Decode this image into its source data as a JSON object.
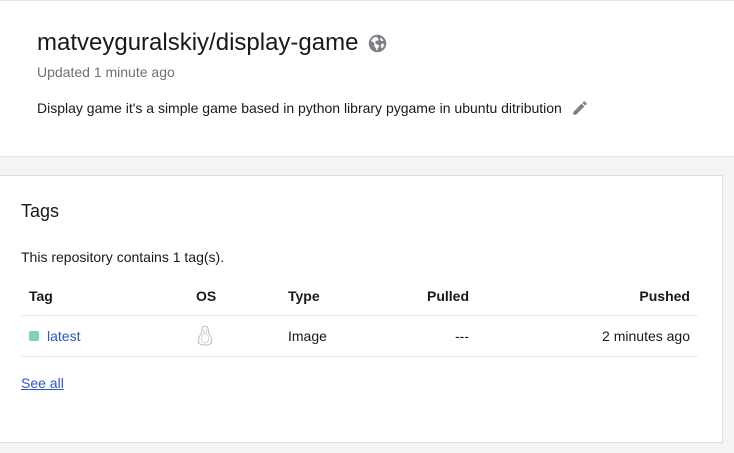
{
  "repo": {
    "title": "matveyguralskiy/display-game",
    "updated": "Updated 1 minute ago",
    "description": "Display game it's a simple game based in python library pygame in ubuntu ditribution",
    "visibility_icon": "globe-icon",
    "edit_icon": "pencil-icon"
  },
  "tags": {
    "heading": "Tags",
    "count_text": "This repository contains 1 tag(s).",
    "columns": {
      "tag": "Tag",
      "os": "OS",
      "type": "Type",
      "pulled": "Pulled",
      "pushed": "Pushed"
    },
    "rows": [
      {
        "tag": "latest",
        "os_icon": "linux-icon",
        "type": "Image",
        "pulled": "---",
        "pushed": "2 minutes ago",
        "status_color": "#7ed6a9"
      }
    ],
    "see_all": "See all"
  },
  "colors": {
    "link": "#2f55c4",
    "muted_text": "#6c717a",
    "icon": "#7d8089"
  }
}
